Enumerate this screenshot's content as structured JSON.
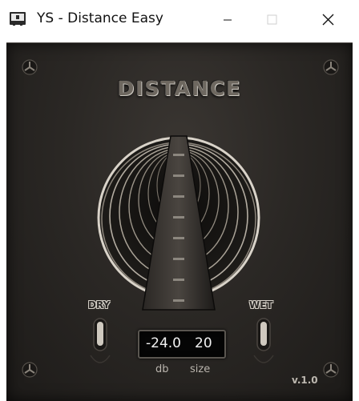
{
  "window": {
    "title": "YS - Distance Easy",
    "icons": {
      "app": "app-icon",
      "minimize": "minimize-icon",
      "maximize": "maximize-icon",
      "close": "close-icon"
    }
  },
  "plugin": {
    "title": "DISTANCE",
    "dry_label": "DRY",
    "wet_label": "WET",
    "db_value": "-24.0",
    "size_value": "20",
    "db_label": "db",
    "size_label": "size",
    "version": "v.1.0"
  },
  "colors": {
    "panel": "#2b2825",
    "display_bg": "#050505",
    "accent_silver": "#c9c4bb"
  }
}
